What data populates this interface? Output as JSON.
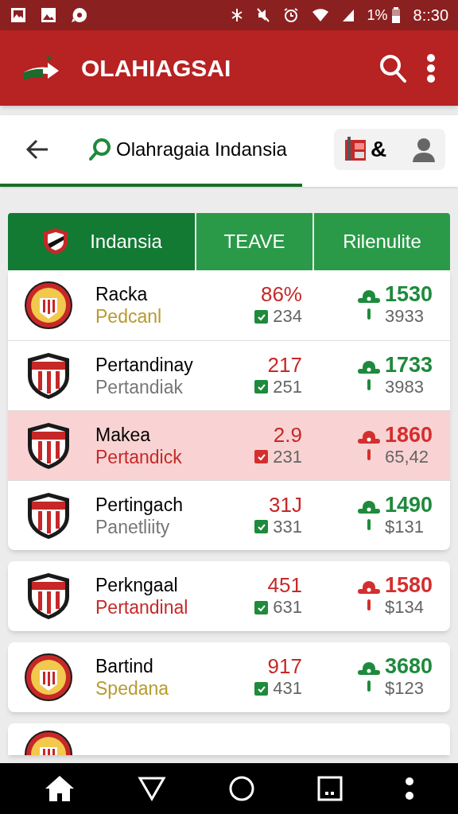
{
  "status_bar": {
    "battery_text": "1%",
    "time": "8::30"
  },
  "app_bar": {
    "title": "OLAHIAGSAI"
  },
  "search": {
    "value": "Olahragaia Indansia",
    "action_text": "&"
  },
  "table": {
    "columns": [
      "Indansia",
      "TEAVE",
      "Rilenulite"
    ],
    "groups": [
      {
        "rows": [
          {
            "kind": "round",
            "name": "Racka",
            "subtitle": {
              "text": "Pedcanl",
              "color": "#b89a2e"
            },
            "stat": "86%",
            "check": {
              "count": "234",
              "color": "#1e8a3c"
            },
            "score": {
              "value": "1530",
              "color": "#1e8a3c"
            },
            "sub_value": "3933",
            "selected": false
          },
          {
            "kind": "shield",
            "name": "Pertandinay",
            "subtitle": {
              "text": "Pertandiak",
              "color": "#777777"
            },
            "stat": "217",
            "check": {
              "count": "251",
              "color": "#1e8a3c"
            },
            "score": {
              "value": "1733",
              "color": "#1e8a3c"
            },
            "sub_value": "3983",
            "selected": false
          },
          {
            "kind": "shield",
            "name": "Makea",
            "subtitle": {
              "text": "Pertandick",
              "color": "#c62828"
            },
            "stat": "2.9",
            "check": {
              "count": "231",
              "color": "#d32f2f"
            },
            "score": {
              "value": "1860",
              "color": "#d32f2f"
            },
            "sub_value": "65,42",
            "selected": true
          },
          {
            "kind": "shield",
            "name": "Pertingach",
            "subtitle": {
              "text": "Panetliity",
              "color": "#777777"
            },
            "stat": "31J",
            "check": {
              "count": "331",
              "color": "#1e8a3c"
            },
            "score": {
              "value": "1490",
              "color": "#1e8a3c"
            },
            "sub_value": "$131",
            "selected": false
          }
        ]
      },
      {
        "rows": [
          {
            "kind": "shield",
            "name": "Perkngaal",
            "subtitle": {
              "text": "Pertandinal",
              "color": "#c62828"
            },
            "stat": "451",
            "check": {
              "count": "631",
              "color": "#1e8a3c"
            },
            "score": {
              "value": "1580",
              "color": "#d32f2f"
            },
            "sub_value": "$134",
            "selected": false
          }
        ]
      },
      {
        "rows": [
          {
            "kind": "round",
            "name": "Bartind",
            "subtitle": {
              "text": "Spedana",
              "color": "#b89a2e"
            },
            "stat": "917",
            "check": {
              "count": "431",
              "color": "#1e8a3c"
            },
            "score": {
              "value": "3680",
              "color": "#1e8a3c"
            },
            "sub_value": "$123",
            "selected": false
          }
        ]
      }
    ],
    "partial_card": {
      "kind": "round"
    }
  }
}
